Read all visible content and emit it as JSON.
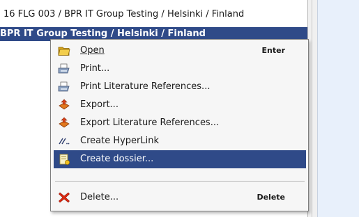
{
  "tree": {
    "row_path": "16 FLG 003 / BPR IT Group Testing / Helsinki / Finland",
    "row_selected": "BPR IT Group Testing / Helsinki / Finland"
  },
  "context_menu": {
    "items": [
      {
        "label": "Open",
        "accelerator": "Enter",
        "icon": "folder-open-icon"
      },
      {
        "label": "Print...",
        "icon": "printer-icon"
      },
      {
        "label": "Print Literature References...",
        "icon": "printer-icon"
      },
      {
        "label": "Export...",
        "icon": "export-icon"
      },
      {
        "label": "Export Literature References...",
        "icon": "export-icon"
      },
      {
        "label": "Create HyperLink",
        "icon": "hyperlink-icon"
      },
      {
        "label": "Create dossier...",
        "icon": "dossier-icon",
        "highlighted": true
      },
      {
        "label": "Delete...",
        "accelerator": "Delete",
        "icon": "delete-icon"
      }
    ]
  },
  "colors": {
    "selection": "#2f4a88",
    "menu_background": "#f6f6f6",
    "right_pane": "#e8f0fb"
  }
}
